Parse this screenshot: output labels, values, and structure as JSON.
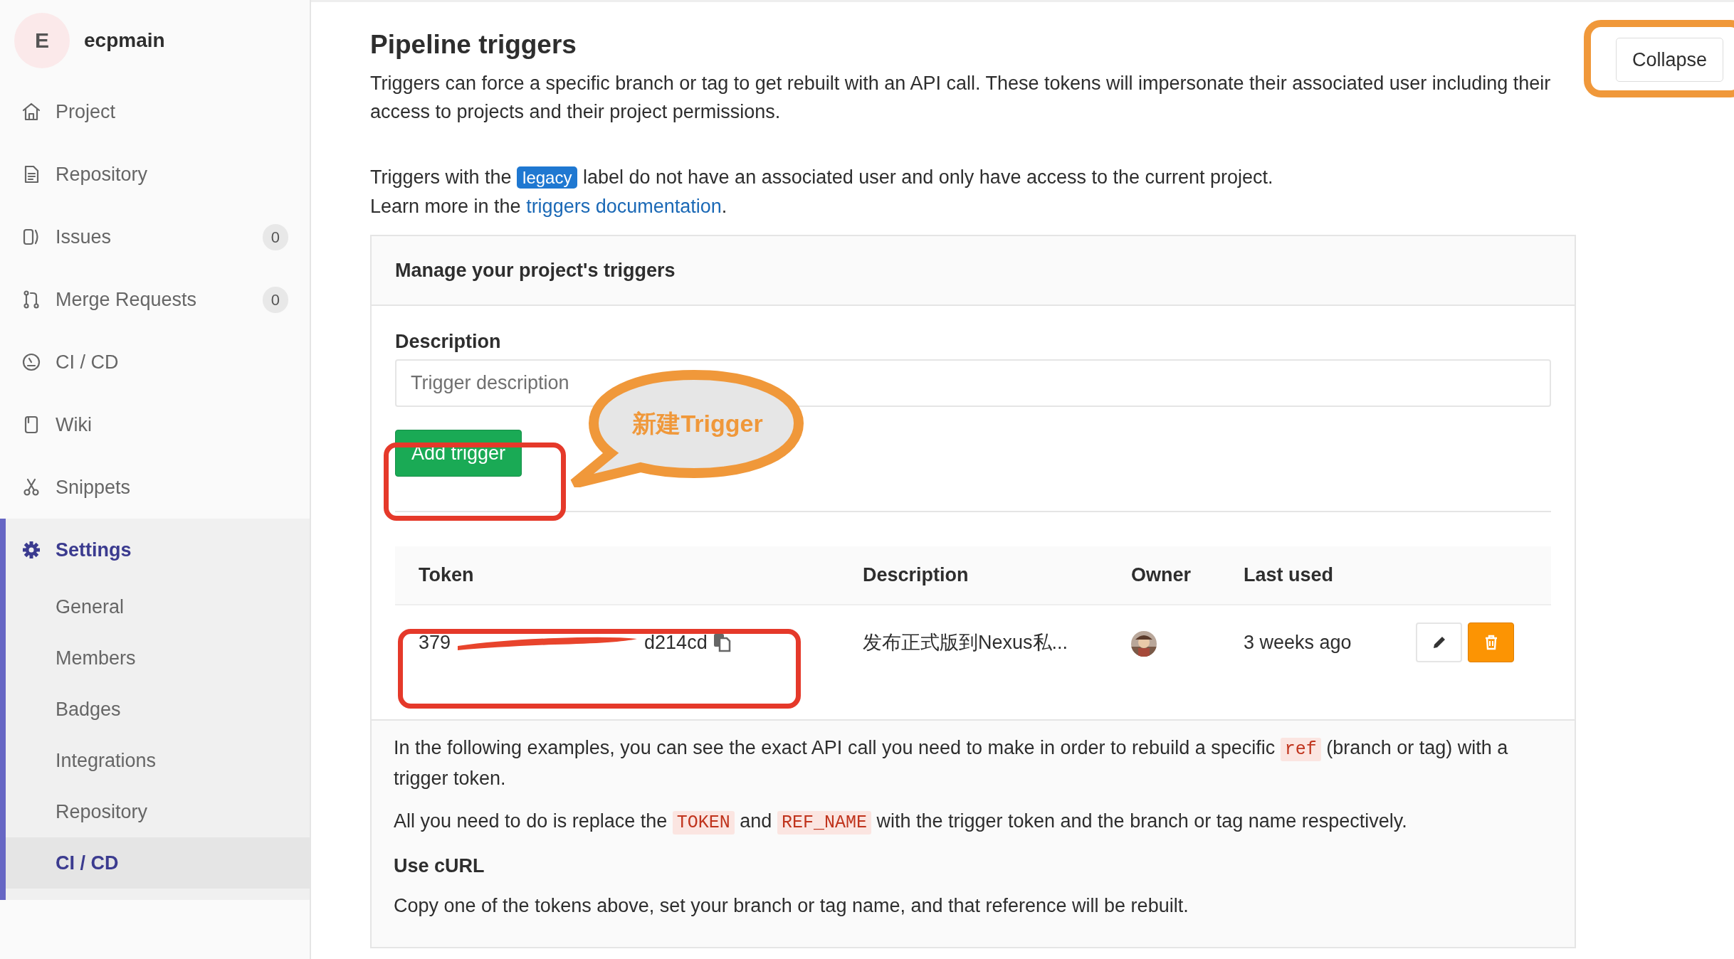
{
  "sidebar": {
    "project": {
      "avatar_letter": "E",
      "name": "ecpmain"
    },
    "items": [
      {
        "label": "Project",
        "selected": false
      },
      {
        "label": "Repository",
        "selected": false
      },
      {
        "label": "Issues",
        "badge": "0",
        "selected": false
      },
      {
        "label": "Merge Requests",
        "badge": "0",
        "selected": false
      },
      {
        "label": "CI / CD",
        "selected": false
      },
      {
        "label": "Wiki",
        "selected": false
      },
      {
        "label": "Snippets",
        "selected": false
      },
      {
        "label": "Settings",
        "selected": true,
        "children": [
          {
            "label": "General",
            "selected": false
          },
          {
            "label": "Members",
            "selected": false
          },
          {
            "label": "Badges",
            "selected": false
          },
          {
            "label": "Integrations",
            "selected": false
          },
          {
            "label": "Repository",
            "selected": false
          },
          {
            "label": "CI / CD",
            "selected": true
          }
        ]
      }
    ]
  },
  "section": {
    "title": "Pipeline triggers",
    "collapse_button": "Collapse",
    "intro": "Triggers can force a specific branch or tag to get rebuilt with an API call. These tokens will impersonate their associated user including their access to projects and their project permissions.",
    "legacy_note": {
      "before": "Triggers with the",
      "badge": "legacy",
      "after": "label do not have an associated user and only have access to the current project."
    },
    "learn_more": {
      "before": "Learn more in the",
      "link": "triggers documentation",
      "after": "."
    }
  },
  "card": {
    "header": "Manage your project's triggers",
    "description_label": "Description",
    "placeholder": "Trigger description",
    "add_button": "Add trigger",
    "columns": [
      "Token",
      "Description",
      "Owner",
      "Last used"
    ],
    "rows": [
      {
        "token_start": "379",
        "token_end": "d214cd",
        "description": "发布正式版到Nexus私...",
        "last_used": "3 weeks ago"
      }
    ],
    "examples": [
      {
        "kind": "paragraph",
        "parts": [
          {
            "kind": "text",
            "text": "In the following examples, you can see the exact API call you need to make in order to rebuild a specific"
          },
          {
            "kind": "code",
            "text": "ref"
          },
          {
            "kind": "text",
            "text": "(branch or tag) with a trigger token."
          }
        ]
      },
      {
        "kind": "paragraph",
        "parts": [
          {
            "kind": "text",
            "text": "All you need to do is replace the"
          },
          {
            "kind": "code",
            "text": "TOKEN"
          },
          {
            "kind": "text",
            "text": "and"
          },
          {
            "kind": "code",
            "text": "REF_NAME"
          },
          {
            "kind": "text",
            "text": "with the trigger token and the branch or tag name respectively."
          }
        ]
      },
      {
        "kind": "heading",
        "parts": [
          {
            "kind": "text",
            "text": "Use cURL"
          }
        ]
      },
      {
        "kind": "paragraph",
        "parts": [
          {
            "kind": "text",
            "text": "Copy one of the tokens above, set your branch or tag name, and that reference will be rebuilt."
          }
        ]
      }
    ]
  },
  "annotations": {
    "callout": "新建Trigger"
  }
}
